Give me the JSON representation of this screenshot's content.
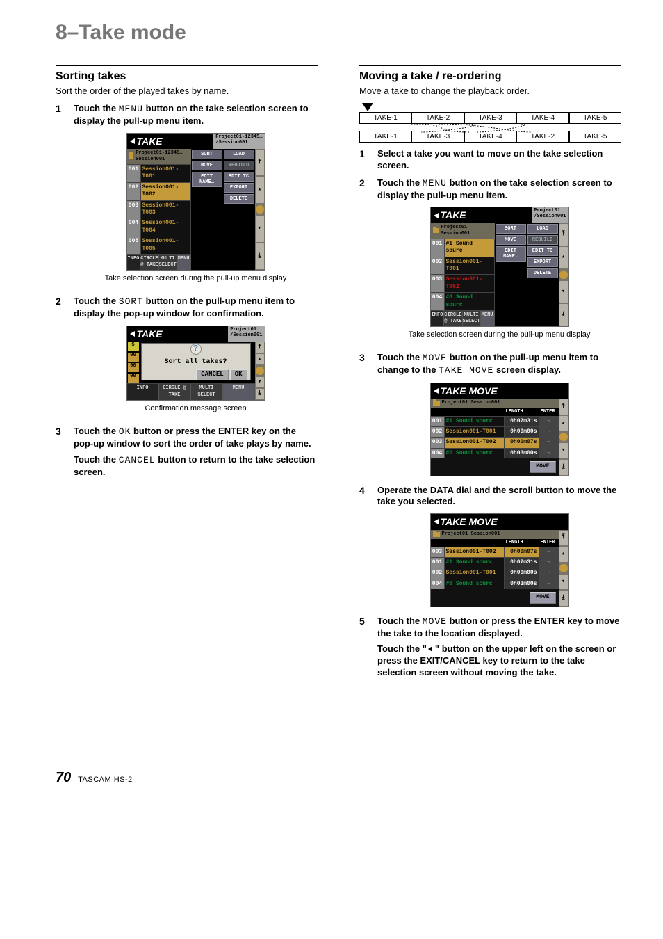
{
  "chapter": "8–Take mode",
  "page_number": "70",
  "model": "TASCAM HS-2",
  "left": {
    "heading": "Sorting takes",
    "intro": "Sort the order of the played takes by name.",
    "step1_pre": "Touch the ",
    "step1_mono": "MENU",
    "step1_post": " button on the take selection screen to display the pull-up menu item.",
    "caption1": "Take selection screen during the pull-up menu display",
    "step2_pre": "Touch the ",
    "step2_mono": "SORT",
    "step2_post": " button on the pull-up menu item to display the pop-up window for confirmation.",
    "caption2": "Confirmation message screen",
    "step3_pre": "Touch the ",
    "step3_mono": "OK",
    "step3_post": " button or press the ENTER key on the pop-up window to sort the order of take plays by name.",
    "step3b_pre": " Touch the ",
    "step3b_mono": "CANCEL",
    "step3b_post": " button to return to the take selection screen.",
    "lcd1": {
      "title": "TAKE",
      "path": "Project01-12345…\n/Session001",
      "pathrow": "Project01-12345…\nSession001",
      "rows": [
        {
          "i": "001",
          "n": "Session001-T001"
        },
        {
          "i": "002",
          "n": "Session001-T002",
          "sel": true
        },
        {
          "i": "003",
          "n": "Session001-T003"
        },
        {
          "i": "004",
          "n": "Session001-T004"
        },
        {
          "i": "005",
          "n": "Session001-T005"
        }
      ],
      "menu1": [
        "SORT",
        "MOVE",
        "EDIT NAME…"
      ],
      "menu2": [
        "LOAD",
        "REBUILD",
        "EDIT TC",
        "EXPORT",
        "DELETE"
      ],
      "bottom": [
        "INFO",
        "CIRCLE @ TAKE",
        "MULTI SELECT",
        "MENU"
      ]
    },
    "lcd2": {
      "title": "TAKE",
      "path": "Project01\n/Session001",
      "question": "Sort all takes?",
      "btns": [
        "CANCEL",
        "OK"
      ],
      "left": [
        "S",
        "00",
        "00",
        "00"
      ],
      "bottom": [
        "INFO",
        "CIRCLE @ TAKE",
        "MULTI SELECT",
        "MENU"
      ]
    }
  },
  "right": {
    "heading": "Moving a take / re-ordering",
    "intro": "Move a take to change the playback order.",
    "reorder_before": [
      "TAKE-1",
      "TAKE-2",
      "TAKE-3",
      "TAKE-4",
      "TAKE-5"
    ],
    "reorder_after": [
      "TAKE-1",
      "TAKE-3",
      "TAKE-4",
      "TAKE-2",
      "TAKE-5"
    ],
    "step1": "Select a take you want to move on the take selection screen.",
    "step2_pre": "Touch the ",
    "step2_mono": "MENU",
    "step2_post": " button on the take selection screen to display the pull-up menu item.",
    "caption1": "Take selection screen during the pull-up menu display",
    "step3_pre": "Touch the ",
    "step3_mono": "MOVE",
    "step3_post": " button on the pull-up menu item to change to the ",
    "step3_mono2": "TAKE MOVE",
    "step3_post2": " screen display.",
    "step4": "Operate the DATA dial and the scroll button to move the take you selected.",
    "step5_pre": "Touch the ",
    "step5_mono": "MOVE",
    "step5_post": " button or press the ENTER key to move the take to the location displayed.",
    "step5b_pre": "Touch the \"",
    "step5b_post": "\" button on the upper left on the screen or press the EXIT/CANCEL key to return to the take selection screen without moving the take.",
    "lcd1": {
      "title": "TAKE",
      "path": "Project01\n/Session001",
      "pathrow": "Project01\nSession001",
      "rows": [
        {
          "i": "001",
          "n": "#1 Sound sourc",
          "sel": true
        },
        {
          "i": "002",
          "n": "Session001-T001"
        },
        {
          "i": "003",
          "n": "Session001-T002",
          "rd": true
        },
        {
          "i": "004",
          "n": "#0 Sound sourc"
        }
      ],
      "menu1": [
        "SORT",
        "MOVE",
        "EDIT NAME…"
      ],
      "menu2": [
        "LOAD",
        "REBUILD",
        "EDIT TC",
        "EXPORT",
        "DELETE"
      ],
      "bottom": [
        "INFO",
        "CIRCLE @ TAKE",
        "MULTI SELECT",
        "MENU"
      ]
    },
    "lcd2": {
      "title": "TAKE MOVE",
      "pathrow": "Project01\nSession001",
      "hdr": [
        "",
        "LENGTH",
        "ENTER"
      ],
      "rows": [
        {
          "i": "001",
          "n": "#1 Sound sourc",
          "l": "0h07m31s"
        },
        {
          "i": "002",
          "n": "Session001-T001",
          "l": "0h00m00s"
        },
        {
          "i": "003",
          "n": "Session001-T002",
          "l": "0h00m07s",
          "sel": true
        },
        {
          "i": "004",
          "n": "#0 Sound sourc",
          "l": "0h03m00s"
        }
      ],
      "movebtn": "MOVE"
    },
    "lcd3": {
      "title": "TAKE MOVE",
      "pathrow": "Project01\nSession001",
      "hdr": [
        "",
        "LENGTH",
        "ENTER"
      ],
      "rows": [
        {
          "i": "003",
          "n": "Session001-T002",
          "l": "0h00m07s",
          "sel": true
        },
        {
          "i": "001",
          "n": "#1 Sound sourc",
          "l": "0h07m31s"
        },
        {
          "i": "002",
          "n": "Session001-T001",
          "l": "0h00m00s"
        },
        {
          "i": "004",
          "n": "#0 Sound sourc",
          "l": "0h03m00s"
        }
      ],
      "movebtn": "MOVE"
    }
  }
}
